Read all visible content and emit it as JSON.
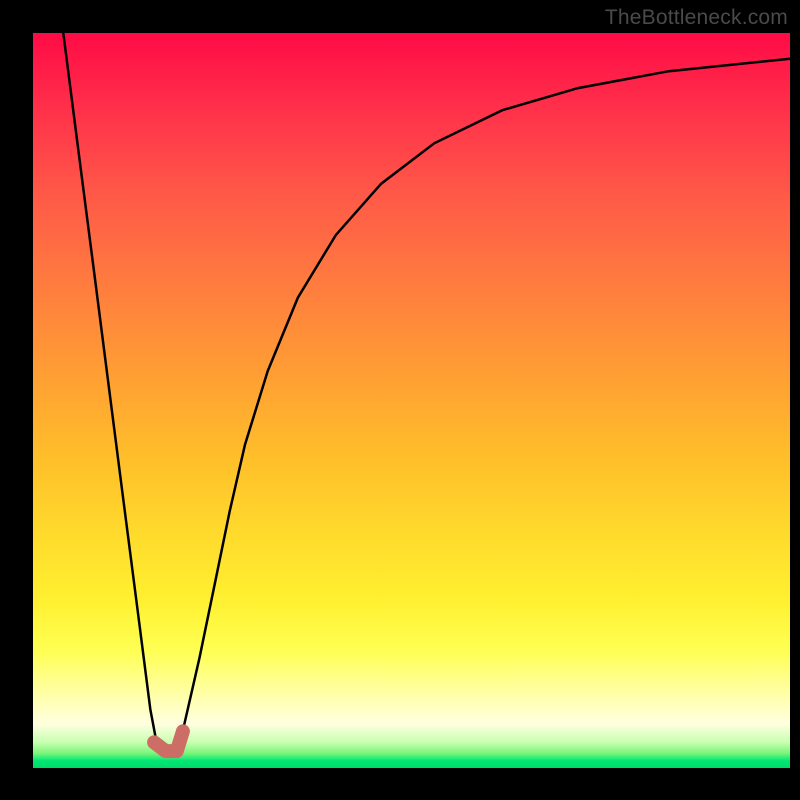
{
  "watermark": "TheBottleneck.com",
  "chart_data": {
    "type": "line",
    "title": "",
    "xlabel": "",
    "ylabel": "",
    "xlim": [
      0,
      100
    ],
    "ylim": [
      0,
      100
    ],
    "gradient_stops": [
      {
        "pct": 0,
        "color": "#ff0b46"
      },
      {
        "pct": 10,
        "color": "#ff2f4a"
      },
      {
        "pct": 22,
        "color": "#ff5948"
      },
      {
        "pct": 35,
        "color": "#ff7e3e"
      },
      {
        "pct": 47,
        "color": "#ffa033"
      },
      {
        "pct": 58,
        "color": "#ffbf2a"
      },
      {
        "pct": 68,
        "color": "#ffda2c"
      },
      {
        "pct": 77,
        "color": "#fff030"
      },
      {
        "pct": 84,
        "color": "#ffff53"
      },
      {
        "pct": 90,
        "color": "#ffffa8"
      },
      {
        "pct": 94,
        "color": "#ffffe0"
      },
      {
        "pct": 96.5,
        "color": "#c8ffb0"
      },
      {
        "pct": 98,
        "color": "#7af57a"
      },
      {
        "pct": 99,
        "color": "#00e874"
      },
      {
        "pct": 100,
        "color": "#00d968"
      }
    ],
    "series": [
      {
        "name": "bottleneck-curve",
        "color": "#000000",
        "width": 2.5,
        "points": [
          {
            "x": 4.0,
            "y": 100.0
          },
          {
            "x": 6.0,
            "y": 84.0
          },
          {
            "x": 8.0,
            "y": 68.0
          },
          {
            "x": 10.0,
            "y": 52.0
          },
          {
            "x": 12.0,
            "y": 36.0
          },
          {
            "x": 14.0,
            "y": 20.0
          },
          {
            "x": 15.5,
            "y": 8.0
          },
          {
            "x": 16.5,
            "y": 2.5
          },
          {
            "x": 18.5,
            "y": 2.5
          },
          {
            "x": 20.0,
            "y": 6.0
          },
          {
            "x": 22.0,
            "y": 15.0
          },
          {
            "x": 24.0,
            "y": 25.0
          },
          {
            "x": 26.0,
            "y": 35.0
          },
          {
            "x": 28.0,
            "y": 44.0
          },
          {
            "x": 31.0,
            "y": 54.0
          },
          {
            "x": 35.0,
            "y": 64.0
          },
          {
            "x": 40.0,
            "y": 72.5
          },
          {
            "x": 46.0,
            "y": 79.5
          },
          {
            "x": 53.0,
            "y": 85.0
          },
          {
            "x": 62.0,
            "y": 89.5
          },
          {
            "x": 72.0,
            "y": 92.5
          },
          {
            "x": 84.0,
            "y": 94.8
          },
          {
            "x": 100.0,
            "y": 96.5
          }
        ]
      },
      {
        "name": "marker-segment",
        "color": "#cc6e66",
        "width": 14,
        "linecap": "round",
        "points": [
          {
            "x": 16.0,
            "y": 3.5
          },
          {
            "x": 17.5,
            "y": 2.3
          },
          {
            "x": 19.0,
            "y": 2.3
          },
          {
            "x": 19.8,
            "y": 5.0
          }
        ]
      }
    ]
  }
}
